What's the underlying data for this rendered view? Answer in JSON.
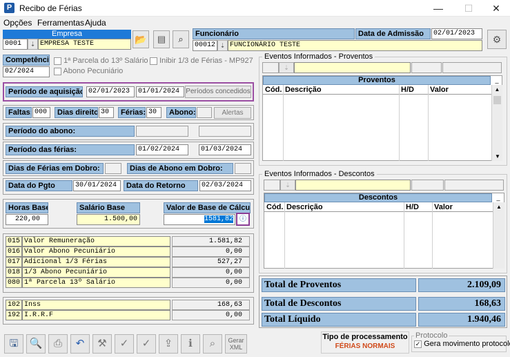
{
  "window": {
    "title": "Recibo de Férias",
    "minimize": "—",
    "maximize": "☐",
    "close": "✕"
  },
  "menu": [
    "Opções",
    "Ferramentas",
    "Ajuda"
  ],
  "empresa": {
    "header": "Empresa",
    "code": "0001",
    "name": "EMPRESA TESTE"
  },
  "funcionario": {
    "header": "Funcionário",
    "code": "00012",
    "name": "FUNCIONÁRIO TESTE",
    "admissao_label": "Data de Admissão",
    "admissao": "02/01/2023"
  },
  "competencia": {
    "label": "Competência",
    "value": "02/2024"
  },
  "options": {
    "parcela13": "1ª Parcela do 13º Salário",
    "abono": "Abono Pecuniário",
    "inibir": "Inibir 1/3 de Férias - MP927"
  },
  "aquisicao": {
    "label": "Período de aquisição:",
    "start": "02/01/2023",
    "end": "01/01/2024",
    "button": "Períodos concedidos"
  },
  "faltas": {
    "label": "Faltas:",
    "value": "000",
    "dias_label": "Dias direito:",
    "dias": "30",
    "ferias_label": "Férias:",
    "ferias": "30",
    "abono_label": "Abono:",
    "alertas": "Alertas"
  },
  "periodo_abono": {
    "label": "Período do abono:"
  },
  "periodo_ferias": {
    "label": "Período das férias:",
    "start": "01/02/2024",
    "end": "01/03/2024"
  },
  "dobro": {
    "ferias_label": "Dias de Férias em Dobro:",
    "abono_label": "Dias de Abono em Dobro:"
  },
  "pgto": {
    "label": "Data do Pgto",
    "value": "30/01/2024",
    "retorno_label": "Data do Retorno",
    "retorno": "02/03/2024"
  },
  "base": {
    "horas_label": "Horas Base",
    "horas": "220,00",
    "salario_label": "Salário Base",
    "salario": "1.500,00",
    "calc_label": "Valor de Base de Cálculo",
    "calc": "1581,82"
  },
  "valores": [
    {
      "code": "015",
      "desc": "Valor Remuneração",
      "value": "1.581,82"
    },
    {
      "code": "016",
      "desc": "Valor Abono Pecuniário",
      "value": "0,00"
    },
    {
      "code": "017",
      "desc": "Adicional 1/3 Férias",
      "value": "527,27"
    },
    {
      "code": "018",
      "desc": "1/3 Abono Pecuniário",
      "value": "0,00"
    },
    {
      "code": "080",
      "desc": "1ª Parcela 13º Salário",
      "value": "0,00"
    }
  ],
  "impostos": [
    {
      "code": "102",
      "desc": "Inss",
      "value": "168,63"
    },
    {
      "code": "192",
      "desc": "I.R.R.F",
      "value": "0,00"
    }
  ],
  "proventos": {
    "group": "Eventos Informados - Proventos",
    "title": "Proventos",
    "cols": [
      "Cód.",
      "Descrição",
      "H/D",
      "Valor"
    ]
  },
  "descontos": {
    "group": "Eventos Informados - Descontos",
    "title": "Descontos",
    "cols": [
      "Cód.",
      "Descrição",
      "H/D",
      "Valor"
    ]
  },
  "totais": {
    "proventos_label": "Total de Proventos",
    "proventos": "2.109,09",
    "descontos_label": "Total de Descontos",
    "descontos": "168,63",
    "liquido_label": "Total Líquido",
    "liquido": "1.940,46"
  },
  "processamento": {
    "label": "Tipo de processamento",
    "value": "FÉRIAS NORMAIS"
  },
  "protocolo": {
    "group": "Protocolo",
    "label": "Gera movimento protocolo"
  },
  "toolbar": {
    "xml_label": "Gerar XML"
  }
}
